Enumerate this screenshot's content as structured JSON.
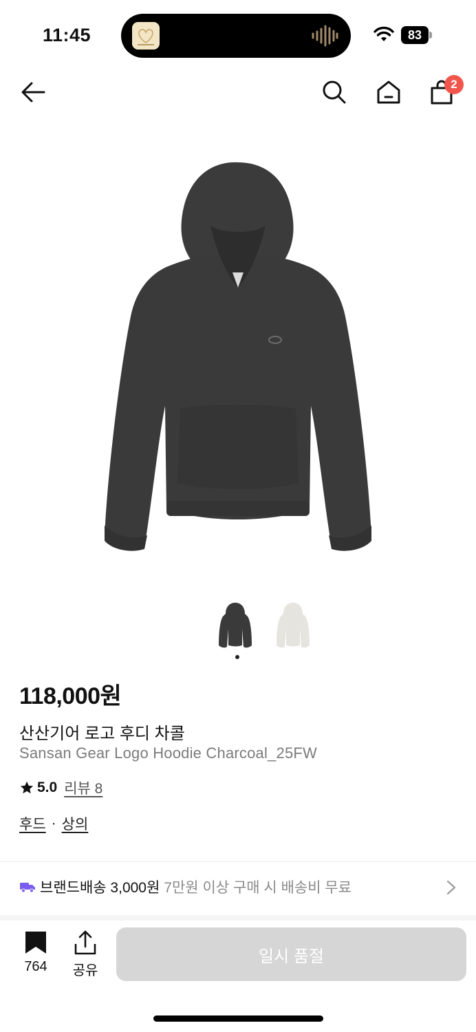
{
  "status_bar": {
    "time": "11:45",
    "battery": "83"
  },
  "nav": {
    "cart_count": "2"
  },
  "product": {
    "price": "118,000원",
    "name_ko": "산산기어 로고 후디 차콜",
    "name_en": "Sansan Gear Logo Hoodie Charcoal_25FW",
    "rating": "5.0",
    "review_label": "리뷰 8",
    "categories": [
      "후드",
      "상의"
    ],
    "category_separator": "·",
    "color_primary": "#3a3a3a",
    "color_alt": "#e6e4de"
  },
  "shipping": {
    "label": "브랜드배송 3,000원",
    "note": "7만원 이상 구매 시 배송비 무료",
    "icon_color": "#7a5cf0"
  },
  "bottom_bar": {
    "bookmark_count": "764",
    "share_label": "공유",
    "soldout_label": "일시 품절"
  }
}
